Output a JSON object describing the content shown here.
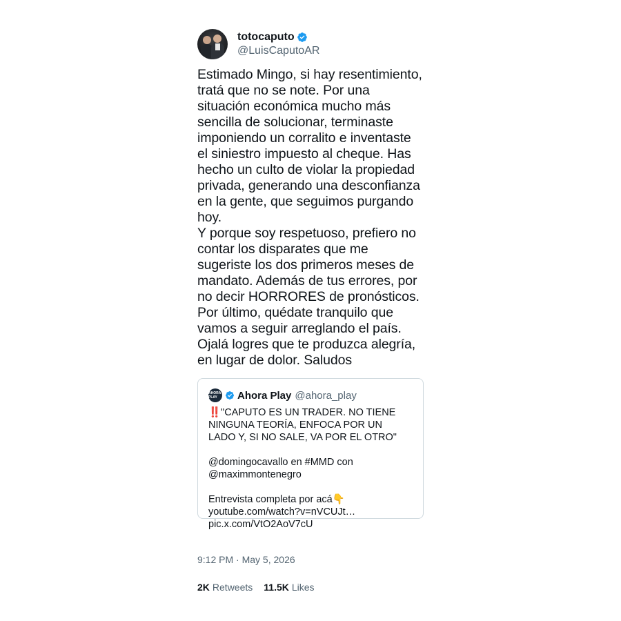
{
  "author": {
    "display_name": "totocaputo",
    "handle": "@LuisCaputoAR",
    "verified_icon": "verified-badge-icon"
  },
  "tweet_text": "Estimado Mingo, si hay resentimiento,\ntratá que no se note. Por una\nsituación económica mucho más\nsencilla de solucionar, terminaste\nimponiendo un corralito e inventaste\nel siniestro impuesto al cheque. Has\nhecho un culto de violar la propiedad\nprivada, generando una desconfianza\nen la gente, que seguimos purgando\nhoy.\nY porque soy respetuoso, prefiero no\ncontar los disparates que me\nsugeriste los dos primeros meses de\nmandato. Además de tus errores, por\nno decir HORRORES de pronósticos.\nPor último, quédate tranquilo que\nvamos a seguir arreglando el país.\nOjalá logres que te produzca alegría,\nen lugar de dolor. Saludos",
  "quoted": {
    "display_name": "Ahora Play",
    "handle": "@ahora_play",
    "avatar_text": "AHORA PLAY",
    "text": "‼️\"CAPUTO ES UN TRADER. NO TIENE\nNINGUNA TEORÍA, ENFOCA POR UN\nLADO Y, SI NO SALE, VA POR EL OTRO\"\n\n@domingocavallo en #MMD con\n@maximmontenegro\n\nEntrevista completa por acá👇\nyoutube.com/watch?v=nVCUJt…\npic.x.com/VtO2AoV7cU"
  },
  "timestamp": {
    "time": "9:12 PM",
    "separator": " · ",
    "date": "May 5, 2026"
  },
  "stats": {
    "retweets_count": "2K",
    "retweets_label": "Retweets",
    "likes_count": "11.5K",
    "likes_label": "Likes"
  },
  "colors": {
    "verified": "#1d9bf0",
    "secondary_text": "#536471",
    "primary_text": "#0f1419",
    "border": "#cfd9de"
  }
}
